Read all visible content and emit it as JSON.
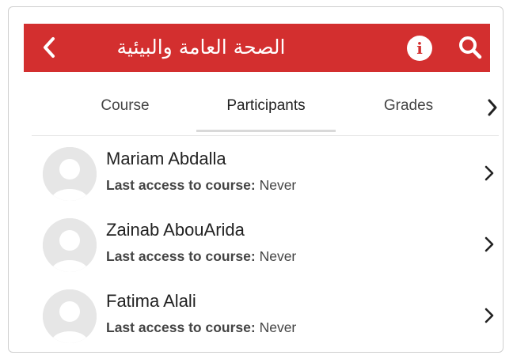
{
  "header": {
    "title": "الصحة العامة والبيئية",
    "back_icon": "chevron-left-icon",
    "info_icon": "info-icon",
    "search_icon": "search-icon",
    "background_color": "#d32f2f"
  },
  "tabs": {
    "items": [
      {
        "label": "Course"
      },
      {
        "label": "Participants",
        "active": true
      },
      {
        "label": "Grades"
      }
    ],
    "more_icon": "chevron-right-icon"
  },
  "participants": [
    {
      "name": "Mariam Abdalla",
      "access_label": "Last access to course:",
      "access_value": "Never"
    },
    {
      "name": "Zainab AbouArida",
      "access_label": "Last access to course:",
      "access_value": "Never"
    },
    {
      "name": "Fatima Alali",
      "access_label": "Last access to course:",
      "access_value": "Never"
    }
  ]
}
